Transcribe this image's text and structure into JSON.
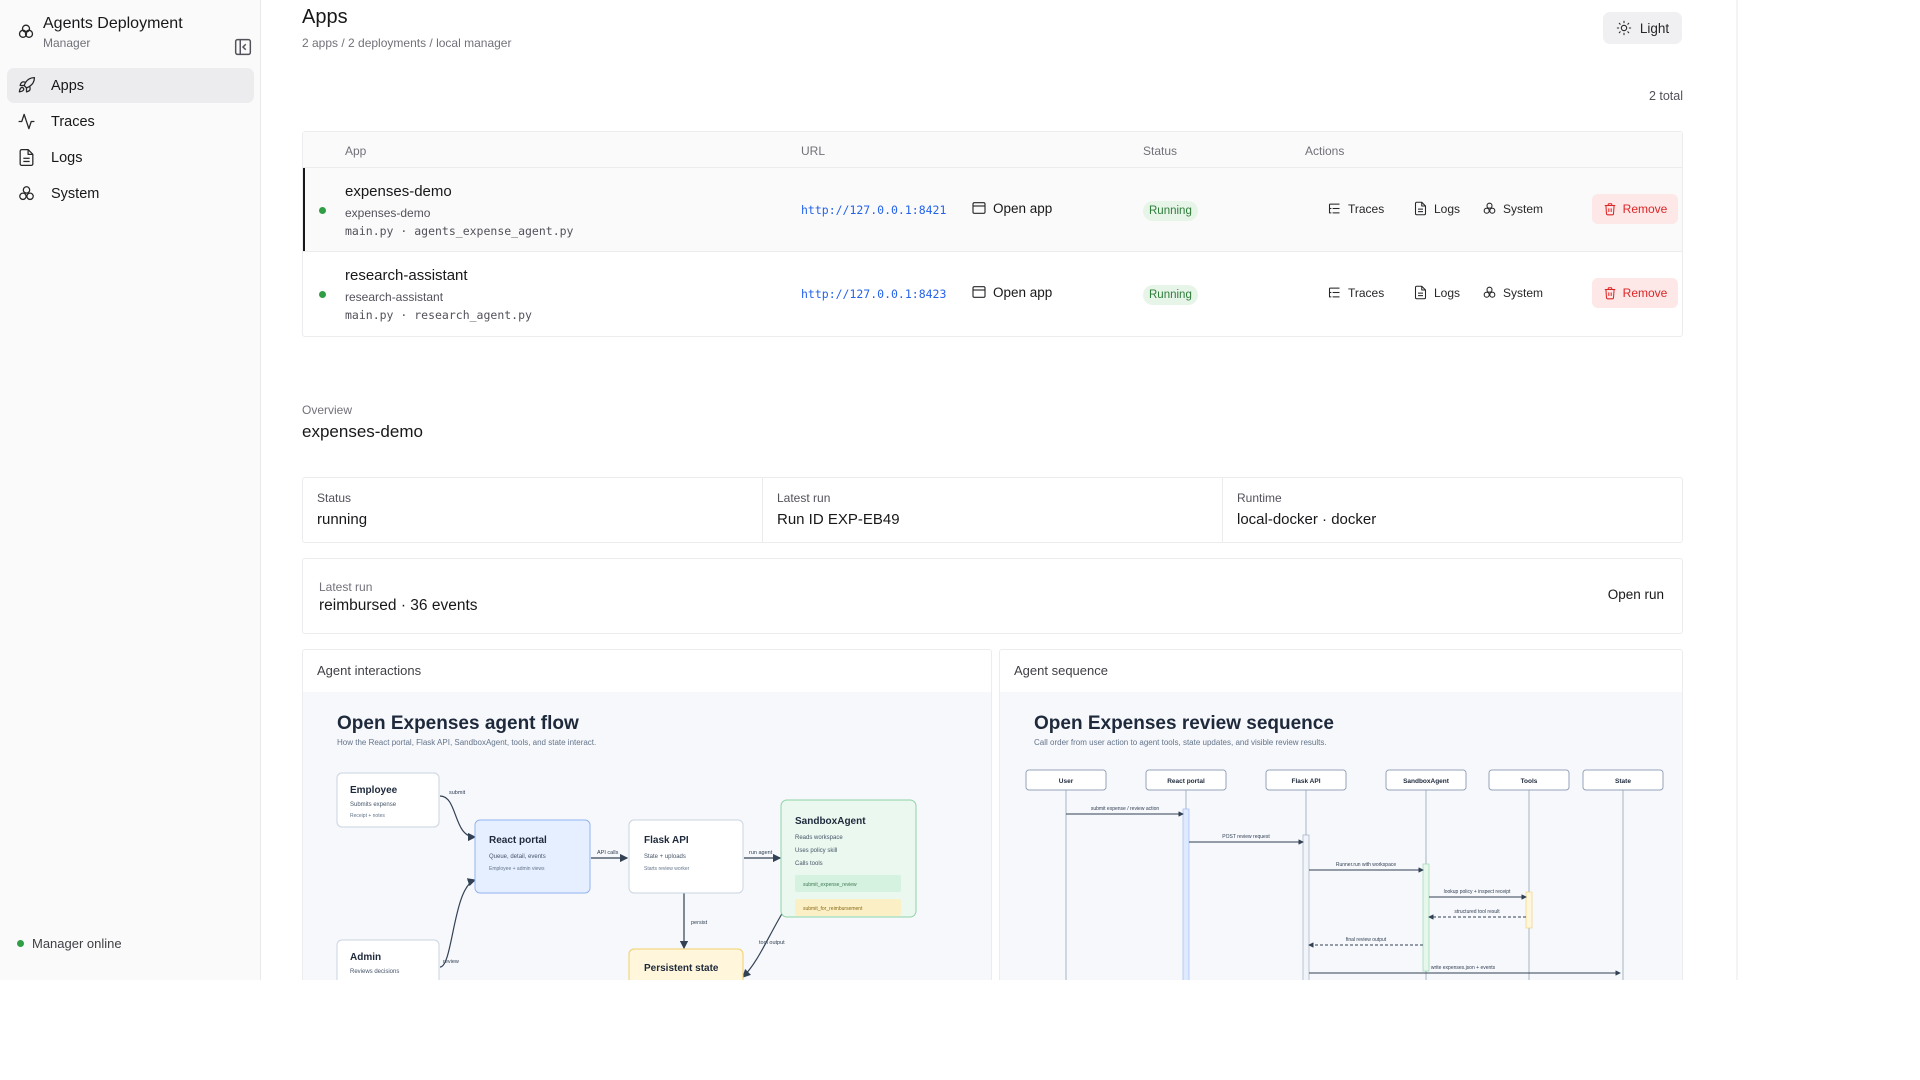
{
  "sidebar": {
    "brand_title": "Agents Deployment",
    "brand_subtitle": "Manager",
    "nav": [
      {
        "label": "Apps",
        "icon": "rocket-icon",
        "active": true
      },
      {
        "label": "Traces",
        "icon": "activity-icon"
      },
      {
        "label": "Logs",
        "icon": "file-text-icon"
      },
      {
        "label": "System",
        "icon": "system-icon"
      }
    ],
    "status_text": "Manager online",
    "status_color": "#2f9e44"
  },
  "header": {
    "title": "Apps",
    "subtitle": "2 apps / 2 deployments / local manager",
    "theme_label": "Light",
    "total_label": "2 total"
  },
  "table": {
    "columns": {
      "app": "App",
      "url": "URL",
      "status": "Status",
      "actions": "Actions"
    },
    "rows": [
      {
        "name": "expenses-demo",
        "id": "expenses-demo",
        "files": "main.py · agents_expense_agent.py",
        "url": "http://127.0.0.1:8421",
        "open_label": "Open app",
        "status": "Running",
        "traces": "Traces",
        "logs": "Logs",
        "system": "System",
        "remove": "Remove",
        "selected": true
      },
      {
        "name": "research-assistant",
        "id": "research-assistant",
        "files": "main.py · research_agent.py",
        "url": "http://127.0.0.1:8423",
        "open_label": "Open app",
        "status": "Running",
        "traces": "Traces",
        "logs": "Logs",
        "system": "System",
        "remove": "Remove",
        "selected": false
      }
    ]
  },
  "overview": {
    "label": "Overview",
    "title": "expenses-demo",
    "stats": [
      {
        "label": "Status",
        "value": "running"
      },
      {
        "label": "Latest run",
        "value": "Run ID EXP-EB49"
      },
      {
        "label": "Runtime",
        "value": "local-docker · docker"
      }
    ],
    "latest_run": {
      "label": "Latest run",
      "value": "reimbursed · 36 events",
      "action": "Open run"
    }
  },
  "flow_panel": {
    "label": "Agent interactions",
    "title": "Open Expenses agent flow",
    "subtitle": "How the React portal, Flask API, SandboxAgent, tools, and state interact.",
    "nodes": {
      "employee": {
        "title": "Employee",
        "line1": "Submits expense",
        "line2": "Receipt + notes"
      },
      "react": {
        "title": "React portal",
        "line1": "Queue, detail, events",
        "line2": "Employee + admin views"
      },
      "flask": {
        "title": "Flask API",
        "line1": "State + uploads",
        "line2": "Starts review worker"
      },
      "sandbox": {
        "title": "SandboxAgent",
        "line1": "Reads workspace",
        "line2": "Uses policy skill",
        "line3": "Calls tools",
        "chip1": "submit_expense_review",
        "chip2": "submit_for_reimbursement"
      },
      "admin": {
        "title": "Admin",
        "line1": "Reviews decisions"
      },
      "state": {
        "title": "Persistent state"
      }
    },
    "edges": {
      "submit": "submit",
      "review": "review",
      "api_calls": "API calls",
      "run_agent": "run agent",
      "persist": "persist",
      "tool_output": "tool output"
    }
  },
  "sequence_panel": {
    "label": "Agent sequence",
    "title": "Open Expenses review sequence",
    "subtitle": "Call order from user action to agent tools, state updates, and visible review results.",
    "actors": [
      "User",
      "React portal",
      "Flask API",
      "SandboxAgent",
      "Tools",
      "State"
    ],
    "messages": [
      "submit expense / review action",
      "POST review request",
      "Runner.run with workspace",
      "lookup policy + inspect receipt",
      "structured tool result",
      "final review output",
      "write expenses.json + events"
    ]
  },
  "colors": {
    "accent": "#2563eb",
    "running_bg": "#e7f5e9",
    "running_fg": "#2f7d3b",
    "remove_bg": "#fde7e7",
    "remove_fg": "#dc2626"
  }
}
